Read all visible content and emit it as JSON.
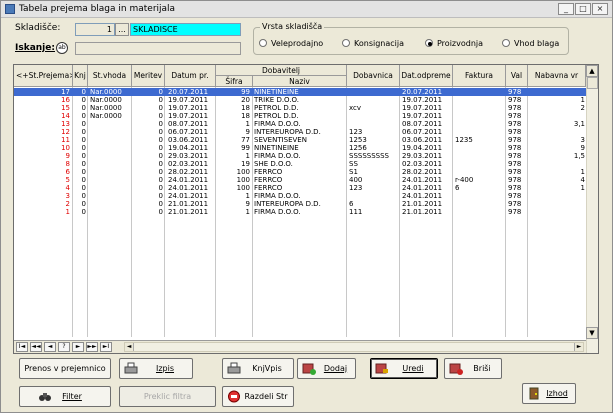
{
  "window": {
    "title": "Tabela prejema blaga in materijala"
  },
  "top": {
    "skladisce_label": "Skladišče:",
    "skladisce_code": "1",
    "skladisce_name": "SKLADISCE",
    "browse_label": "...",
    "iskanje_label": "Iskanje:",
    "iskanje_icon_text": "ab"
  },
  "vrsta": {
    "legend": "Vrsta skladišča",
    "options": [
      "Veleprodajno",
      "Konsignacija",
      "Proizvodnja",
      "Vhod blaga"
    ],
    "selected": "Proizvodnja"
  },
  "grid": {
    "headers": {
      "st_prejema": "<+St.Prejema>",
      "knj": "Knj",
      "st_vhoda": "St.vhoda",
      "meritev": "Meritev",
      "datum": "Datum pr.",
      "dobavitelj": "Dobavitelj",
      "sifra": "Šifra",
      "naziv": "Naziv",
      "dobavnica": "Dobavnica",
      "dat_odpreme": "Dat.odpreme",
      "faktura": "Faktura",
      "val": "Val",
      "nabavna": "Nabavna vr"
    },
    "rows": [
      {
        "st": "17",
        "knj": "0",
        "vhod": "Nar.0000",
        "mer": "0",
        "dat": "20.07.2011",
        "sif": "99",
        "naz": "NINETINEINE",
        "dob": "",
        "odp": "20.07.2011",
        "fak": "",
        "val": "978",
        "nab": ""
      },
      {
        "st": "16",
        "knj": "0",
        "vhod": "Nar.0000",
        "mer": "0",
        "dat": "19.07.2011",
        "sif": "20",
        "naz": "TRIKE D.O.O.",
        "dob": "",
        "odp": "19.07.2011",
        "fak": "",
        "val": "978",
        "nab": "1"
      },
      {
        "st": "15",
        "knj": "0",
        "vhod": "Nar.0000",
        "mer": "0",
        "dat": "19.07.2011",
        "sif": "18",
        "naz": "PETROL D.D.",
        "dob": "xcv",
        "odp": "19.07.2011",
        "fak": "",
        "val": "978",
        "nab": "2"
      },
      {
        "st": "14",
        "knj": "0",
        "vhod": "Nar.0000",
        "mer": "0",
        "dat": "19.07.2011",
        "sif": "18",
        "naz": "PETROL D.D.",
        "dob": "",
        "odp": "19.07.2011",
        "fak": "",
        "val": "978",
        "nab": ""
      },
      {
        "st": "13",
        "knj": "0",
        "vhod": "",
        "mer": "0",
        "dat": "08.07.2011",
        "sif": "1",
        "naz": "FIRMA D.O.O.",
        "dob": "",
        "odp": "08.07.2011",
        "fak": "",
        "val": "978",
        "nab": "3,1"
      },
      {
        "st": "12",
        "knj": "0",
        "vhod": "",
        "mer": "0",
        "dat": "06.07.2011",
        "sif": "9",
        "naz": "INTEREUROPA D.D.",
        "dob": "123",
        "odp": "06.07.2011",
        "fak": "",
        "val": "978",
        "nab": ""
      },
      {
        "st": "11",
        "knj": "0",
        "vhod": "",
        "mer": "0",
        "dat": "03.06.2011",
        "sif": "77",
        "naz": "SEVENTISEVEN",
        "dob": "1253",
        "odp": "03.06.2011",
        "fak": "1235",
        "val": "978",
        "nab": "3"
      },
      {
        "st": "10",
        "knj": "0",
        "vhod": "",
        "mer": "0",
        "dat": "19.04.2011",
        "sif": "99",
        "naz": "NINETINEINE",
        "dob": "1256",
        "odp": "19.04.2011",
        "fak": "",
        "val": "978",
        "nab": "9"
      },
      {
        "st": "9",
        "knj": "0",
        "vhod": "",
        "mer": "0",
        "dat": "29.03.2011",
        "sif": "1",
        "naz": "FIRMA D.O.O.",
        "dob": "SSSSSSSSS",
        "odp": "29.03.2011",
        "fak": "",
        "val": "978",
        "nab": "1,5"
      },
      {
        "st": "8",
        "knj": "0",
        "vhod": "",
        "mer": "0",
        "dat": "02.03.2011",
        "sif": "19",
        "naz": "SHE D.O.O.",
        "dob": "SS",
        "odp": "02.03.2011",
        "fak": "",
        "val": "978",
        "nab": ""
      },
      {
        "st": "6",
        "knj": "0",
        "vhod": "",
        "mer": "0",
        "dat": "28.02.2011",
        "sif": "100",
        "naz": "FERRCO",
        "dob": "S1",
        "odp": "28.02.2011",
        "fak": "",
        "val": "978",
        "nab": "1"
      },
      {
        "st": "5",
        "knj": "0",
        "vhod": "",
        "mer": "0",
        "dat": "24.01.2011",
        "sif": "100",
        "naz": "FERRCO",
        "dob": "400",
        "odp": "24.01.2011",
        "fak": "r-400",
        "val": "978",
        "nab": "4"
      },
      {
        "st": "4",
        "knj": "0",
        "vhod": "",
        "mer": "0",
        "dat": "24.01.2011",
        "sif": "100",
        "naz": "FERRCO",
        "dob": "123",
        "odp": "24.01.2011",
        "fak": "6",
        "val": "978",
        "nab": "1"
      },
      {
        "st": "3",
        "knj": "0",
        "vhod": "",
        "mer": "0",
        "dat": "24.01.2011",
        "sif": "1",
        "naz": "FIRMA D.O.O.",
        "dob": "",
        "odp": "24.01.2011",
        "fak": "",
        "val": "978",
        "nab": ""
      },
      {
        "st": "2",
        "knj": "0",
        "vhod": "",
        "mer": "0",
        "dat": "21.01.2011",
        "sif": "9",
        "naz": "INTEREUROPA D.D.",
        "dob": "6",
        "odp": "21.01.2011",
        "fak": "",
        "val": "978",
        "nab": ""
      },
      {
        "st": "1",
        "knj": "0",
        "vhod": "",
        "mer": "0",
        "dat": "21.01.2011",
        "sif": "1",
        "naz": "FIRMA D.O.O.",
        "dob": "111",
        "odp": "21.01.2011",
        "fak": "",
        "val": "978",
        "nab": ""
      }
    ],
    "selected_row": 0,
    "nav_labels": [
      "I◄",
      "◄◄",
      "◄",
      "?",
      "►",
      "►►",
      "►I"
    ]
  },
  "buttons": {
    "prenos": "Prenos v prejemnico",
    "izpis": "Izpis",
    "knjvpis": "KnjVpis",
    "dodaj": "Dodaj",
    "uredi": "Uredi",
    "brisi": "Briši",
    "filter": "Filter",
    "preklic": "Preklic filtra",
    "razdeli": "Razdeli Str",
    "izhod": "Izhod"
  },
  "colors": {
    "selection": "#3d6ad0",
    "st_color": "#e00000",
    "accent_cyan": "#00ffff"
  }
}
